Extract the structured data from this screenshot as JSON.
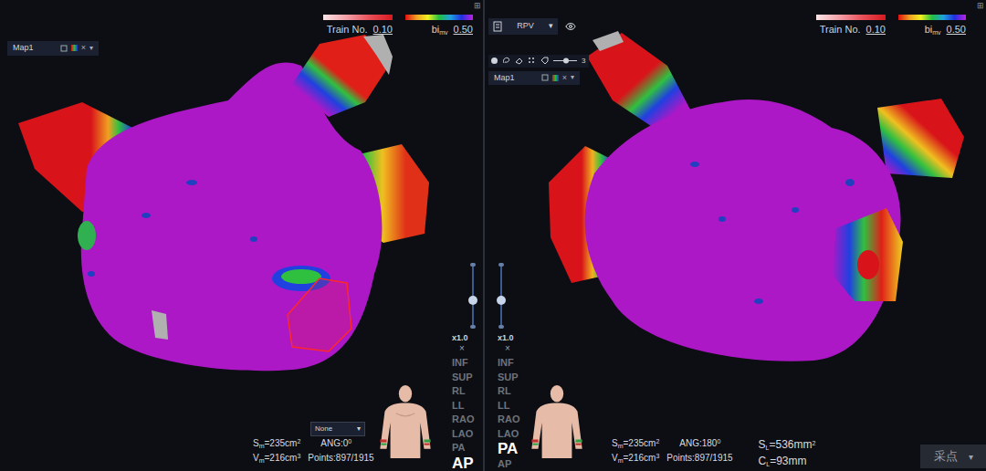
{
  "left_view": {
    "corner_icon": "⊞",
    "legend": {
      "train_label": "Train No.",
      "train_min": "0.10",
      "bi_label": "bi",
      "bi_unit": "mv",
      "bi_max": "0.50"
    },
    "map_selector": {
      "label": "Map1",
      "close": "×",
      "caret": "▾"
    },
    "zoom": {
      "level": 0.42,
      "reading": "x1.0",
      "close": "×"
    },
    "orientations": [
      {
        "label": "INF",
        "selected": false
      },
      {
        "label": "SUP",
        "selected": false
      },
      {
        "label": "RL",
        "selected": false
      },
      {
        "label": "LL",
        "selected": false
      },
      {
        "label": "RAO",
        "selected": false
      },
      {
        "label": "LAO",
        "selected": false
      },
      {
        "label": "PA",
        "selected": false
      },
      {
        "label": "AP",
        "selected": true
      }
    ],
    "view_select": {
      "value": "None",
      "caret": "▾"
    },
    "stats": {
      "surface": {
        "symbol": "S",
        "sub": "m",
        "value": "=235cm",
        "sup": "2"
      },
      "volume": {
        "symbol": "V",
        "sub": "m",
        "value": "=216cm",
        "sup": "3"
      },
      "angle": {
        "text": "ANG:0",
        "sup": "0"
      },
      "points": "Points:897/1915"
    }
  },
  "right_view": {
    "corner_icon": "⊞",
    "legend": {
      "train_label": "Train No.",
      "train_min": "0.10",
      "bi_label": "bi",
      "bi_unit": "mv",
      "bi_max": "0.50"
    },
    "vein_select": {
      "value": "RPV",
      "caret": "▾"
    },
    "tool_count": "3",
    "map_selector": {
      "label": "Map1",
      "close": "×",
      "caret": "▾"
    },
    "zoom": {
      "level": 0.42,
      "reading": "x1.0",
      "close": "×"
    },
    "orientations": [
      {
        "label": "INF",
        "selected": false
      },
      {
        "label": "SUP",
        "selected": false
      },
      {
        "label": "RL",
        "selected": false
      },
      {
        "label": "LL",
        "selected": false
      },
      {
        "label": "RAO",
        "selected": false
      },
      {
        "label": "LAO",
        "selected": false
      },
      {
        "label": "PA",
        "selected": true
      },
      {
        "label": "AP",
        "selected": false
      }
    ],
    "stats": {
      "surface": {
        "symbol": "S",
        "sub": "m",
        "value": "=235cm",
        "sup": "2"
      },
      "volume": {
        "symbol": "V",
        "sub": "m",
        "value": "=216cm",
        "sup": "3"
      },
      "angle": {
        "text": "ANG:180",
        "sup": "0"
      },
      "points": "Points:897/1915"
    },
    "extra_stats": {
      "surface": {
        "symbol": "S",
        "sub": "L",
        "value": "=536mm",
        "sup": "2"
      },
      "length": {
        "symbol": "C",
        "sub": "L",
        "value": "=93mm",
        "sup": ""
      }
    }
  },
  "capture_button": {
    "label": "采点",
    "caret": "▾"
  }
}
